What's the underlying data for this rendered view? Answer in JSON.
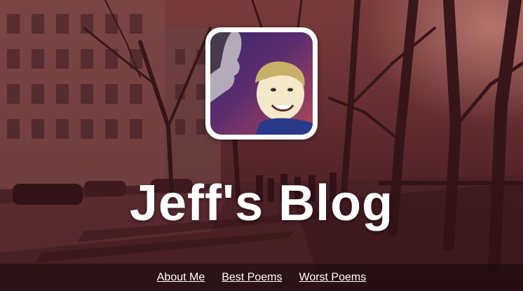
{
  "header": {
    "title": "Jeff's Blog"
  },
  "avatar": {
    "icon": "profile-photo"
  },
  "nav": {
    "items": [
      {
        "label": "About Me"
      },
      {
        "label": "Best Poems"
      },
      {
        "label": "Worst Poems"
      }
    ]
  },
  "colors": {
    "title_text": "#ffffff",
    "nav_text": "#ffffff",
    "background_tint": "#6a3436"
  }
}
